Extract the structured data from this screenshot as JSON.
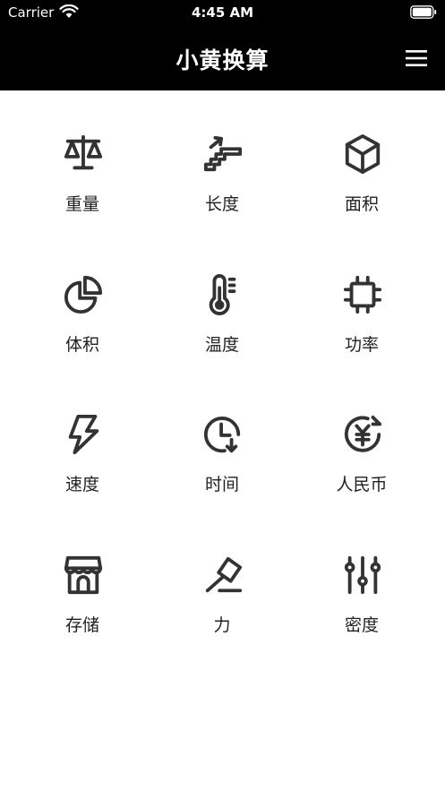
{
  "status_bar": {
    "carrier": "Carrier",
    "time": "4:45 AM"
  },
  "nav": {
    "title": "小黄换算",
    "menu_icon": "hamburger-menu-icon"
  },
  "colors": {
    "header_bg": "#000000",
    "icon_color": "#333333",
    "text_color": "#222222"
  },
  "categories": [
    {
      "label": "重量",
      "icon": "scale-icon"
    },
    {
      "label": "长度",
      "icon": "escalator-icon"
    },
    {
      "label": "面积",
      "icon": "cube-icon"
    },
    {
      "label": "体积",
      "icon": "pie-chart-icon"
    },
    {
      "label": "温度",
      "icon": "thermometer-icon"
    },
    {
      "label": "功率",
      "icon": "chip-icon"
    },
    {
      "label": "速度",
      "icon": "lightning-icon"
    },
    {
      "label": "时间",
      "icon": "clock-icon"
    },
    {
      "label": "人民币",
      "icon": "yuan-exchange-icon"
    },
    {
      "label": "存储",
      "icon": "storefront-icon"
    },
    {
      "label": "力",
      "icon": "gavel-icon"
    },
    {
      "label": "密度",
      "icon": "sliders-icon"
    }
  ]
}
